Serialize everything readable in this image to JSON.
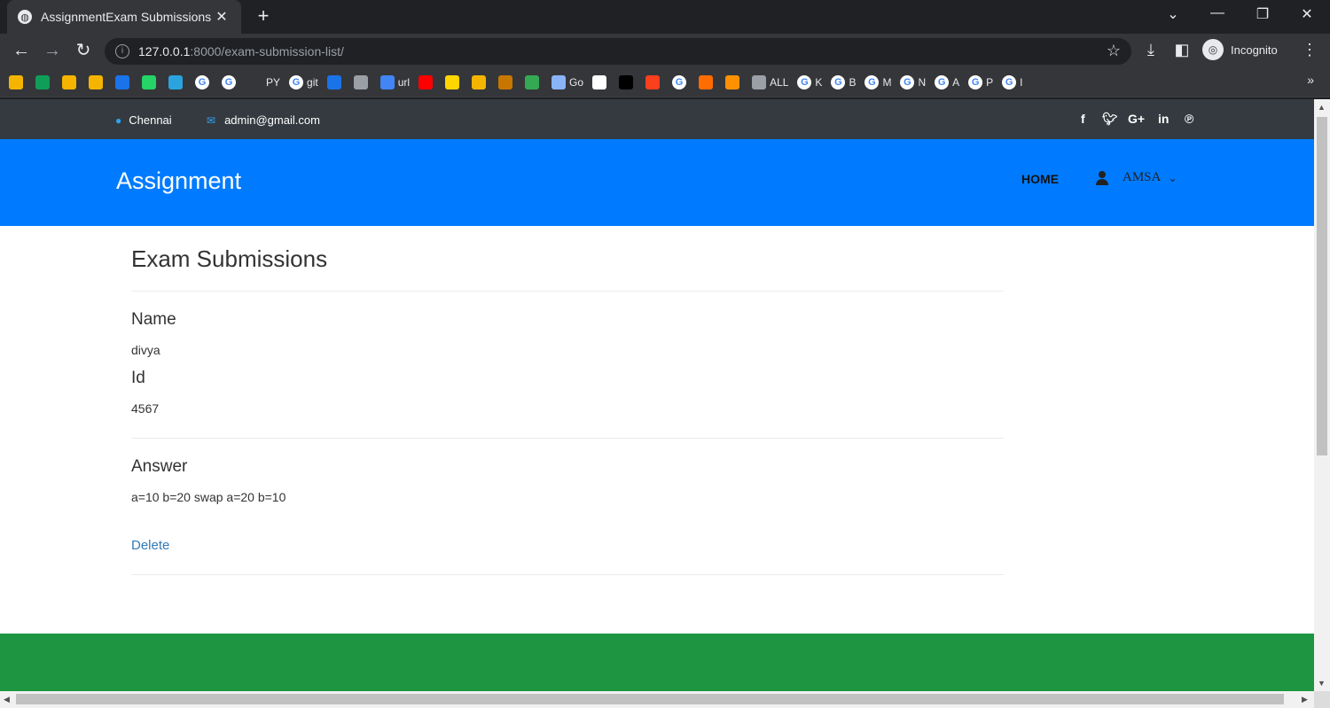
{
  "browser": {
    "tab_title": "AssignmentExam Submissions",
    "url_host": "127.0.0.1",
    "url_path": ":8000/exam-submission-list/",
    "incognito_label": "Incognito",
    "bookmarks": [
      {
        "label": "",
        "icon": "drive-icon",
        "color": "#f4b400"
      },
      {
        "label": "",
        "icon": "plus-icon",
        "color": "#0f9d58"
      },
      {
        "label": "",
        "icon": "gift-icon",
        "color": "#f4b400"
      },
      {
        "label": "",
        "icon": "bar-chart-icon",
        "color": "#f4b400"
      },
      {
        "label": "",
        "icon": "ieee-icon",
        "color": "#1a73e8"
      },
      {
        "label": "",
        "icon": "whatsapp-icon",
        "color": "#25d366"
      },
      {
        "label": "",
        "icon": "telegram-icon",
        "color": "#2aa3df"
      },
      {
        "label": "",
        "icon": "google-icon",
        "color": "#ffffff"
      },
      {
        "label": "",
        "icon": "google-icon",
        "color": "#ffffff"
      },
      {
        "label": "PY",
        "icon": "github-icon",
        "color": "#35363a"
      },
      {
        "label": "git",
        "icon": "google-icon",
        "color": "#ffffff"
      },
      {
        "label": "",
        "icon": "calendar-icon",
        "color": "#1a73e8"
      },
      {
        "label": "",
        "icon": "store-icon",
        "color": "#9aa0a6"
      },
      {
        "label": "url",
        "icon": "cloud-icon",
        "color": "#4285f4"
      },
      {
        "label": "",
        "icon": "youtube-icon",
        "color": "#ff0000"
      },
      {
        "label": "",
        "icon": "p-icon",
        "color": "#ffd600"
      },
      {
        "label": "",
        "icon": "camera-icon",
        "color": "#f4b400"
      },
      {
        "label": "",
        "icon": "badge-icon",
        "color": "#c77700"
      },
      {
        "label": "",
        "icon": "ring-icon",
        "color": "#34a853"
      },
      {
        "label": "Go",
        "icon": "swirl-icon",
        "color": "#8ab4f8"
      },
      {
        "label": "",
        "icon": "doc-icon",
        "color": "#ffffff"
      },
      {
        "label": "",
        "icon": "cl-icon",
        "color": "#000000"
      },
      {
        "label": "",
        "icon": "yandex-icon",
        "color": "#fc3f1d"
      },
      {
        "label": "",
        "icon": "google-icon",
        "color": "#ffffff"
      },
      {
        "label": "",
        "icon": "plane-icon",
        "color": "#ff6d00"
      },
      {
        "label": "",
        "icon": "eye-icon",
        "color": "#ff9100"
      },
      {
        "label": "ALL",
        "icon": "globe-icon",
        "color": "#9aa0a6"
      },
      {
        "label": "K",
        "icon": "google-icon",
        "color": "#ffffff"
      },
      {
        "label": "B",
        "icon": "google-icon",
        "color": "#ffffff"
      },
      {
        "label": "M",
        "icon": "google-icon",
        "color": "#ffffff"
      },
      {
        "label": "N",
        "icon": "google-icon",
        "color": "#ffffff"
      },
      {
        "label": "A",
        "icon": "google-icon",
        "color": "#ffffff"
      },
      {
        "label": "P",
        "icon": "google-icon",
        "color": "#ffffff"
      },
      {
        "label": "I",
        "icon": "google-icon",
        "color": "#ffffff"
      }
    ]
  },
  "topbar": {
    "location": "Chennai",
    "email": "admin@gmail.com",
    "social": [
      "facebook-icon",
      "twitter-icon",
      "google-plus-icon",
      "linkedin-icon",
      "pinterest-icon"
    ]
  },
  "navbar": {
    "brand": "Assignment",
    "home": "HOME",
    "user": "AMSA"
  },
  "submission": {
    "page_title": "Exam Submissions",
    "name_label": "Name",
    "name_value": "divya",
    "id_label": "Id",
    "id_value": "4567",
    "answer_label": "Answer",
    "answer_value": "a=10 b=20 swap a=20 b=10",
    "delete_label": "Delete"
  },
  "colors": {
    "navbar": "#007bff",
    "topbar": "#343a40",
    "footer": "#1e9540",
    "link": "#337ab7"
  }
}
